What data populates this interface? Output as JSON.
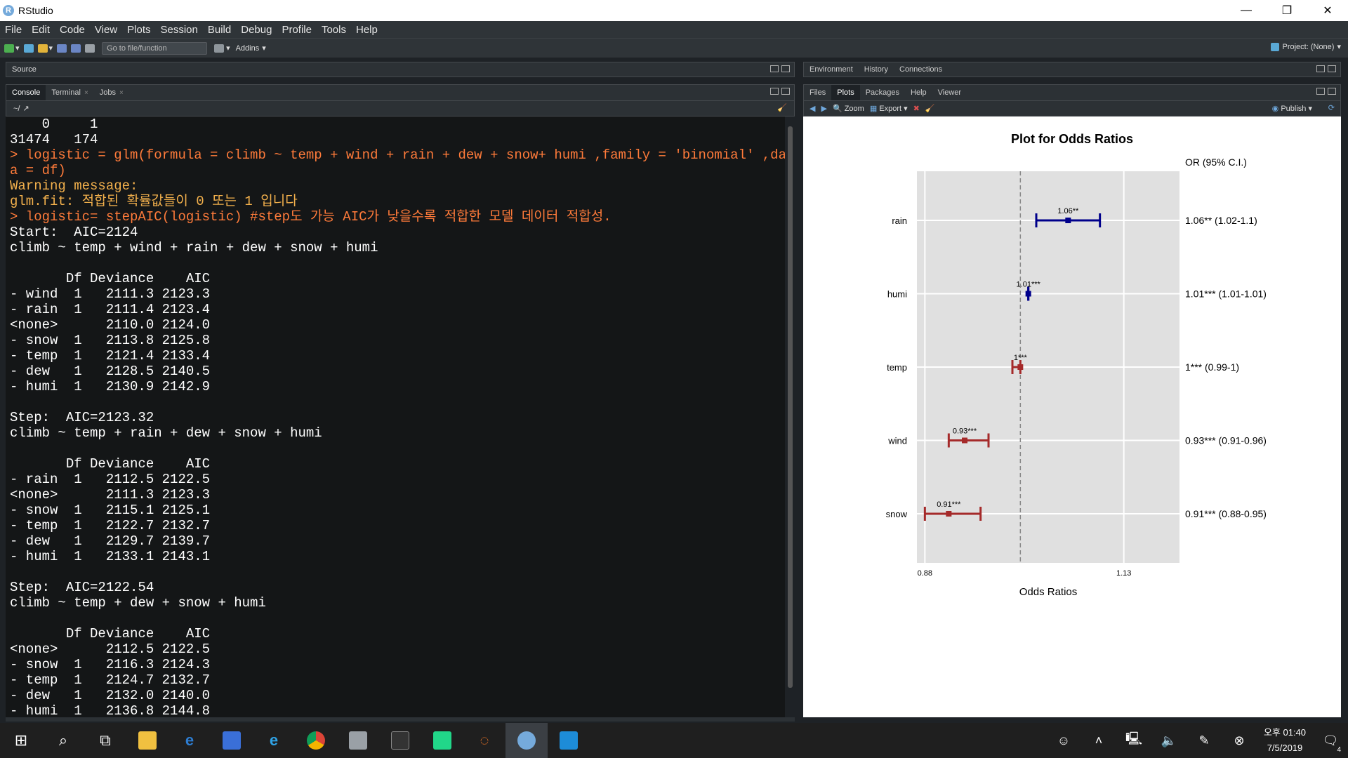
{
  "window": {
    "title": "RStudio",
    "minimize": "—",
    "restore": "❐",
    "close": "✕"
  },
  "menu": [
    "File",
    "Edit",
    "Code",
    "View",
    "Plots",
    "Session",
    "Build",
    "Debug",
    "Profile",
    "Tools",
    "Help"
  ],
  "toolbar": {
    "goto_placeholder": "Go to file/function",
    "addins": "Addins",
    "project": "Project: (None)"
  },
  "source_pane": {
    "label": "Source"
  },
  "console_pane": {
    "tabs": [
      {
        "label": "Console"
      },
      {
        "label": "Terminal"
      },
      {
        "label": "Jobs"
      }
    ],
    "path": "~/",
    "lines": [
      {
        "t": "out",
        "text": "    0     1"
      },
      {
        "t": "out",
        "text": "31474   174"
      },
      {
        "t": "cmd",
        "text": "> logistic = glm(formula = climb ~ temp + wind + rain + dew + snow+ humi ,family = 'binomial' ,dat"
      },
      {
        "t": "cmd",
        "text": "a = df)"
      },
      {
        "t": "warn",
        "text": "Warning message:"
      },
      {
        "t": "warn",
        "text": "glm.fit: 적합된 확률값들이 0 또는 1 입니다"
      },
      {
        "t": "cmd",
        "text": "> logistic= stepAIC(logistic) #step도 가능 AIC가 낮을수록 적합한 모델 데이터 적합성."
      },
      {
        "t": "out",
        "text": "Start:  AIC=2124"
      },
      {
        "t": "out",
        "text": "climb ~ temp + wind + rain + dew + snow + humi"
      },
      {
        "t": "out",
        "text": ""
      },
      {
        "t": "out",
        "text": "       Df Deviance    AIC"
      },
      {
        "t": "out",
        "text": "- wind  1   2111.3 2123.3"
      },
      {
        "t": "out",
        "text": "- rain  1   2111.4 2123.4"
      },
      {
        "t": "out",
        "text": "<none>      2110.0 2124.0"
      },
      {
        "t": "out",
        "text": "- snow  1   2113.8 2125.8"
      },
      {
        "t": "out",
        "text": "- temp  1   2121.4 2133.4"
      },
      {
        "t": "out",
        "text": "- dew   1   2128.5 2140.5"
      },
      {
        "t": "out",
        "text": "- humi  1   2130.9 2142.9"
      },
      {
        "t": "out",
        "text": ""
      },
      {
        "t": "out",
        "text": "Step:  AIC=2123.32"
      },
      {
        "t": "out",
        "text": "climb ~ temp + rain + dew + snow + humi"
      },
      {
        "t": "out",
        "text": ""
      },
      {
        "t": "out",
        "text": "       Df Deviance    AIC"
      },
      {
        "t": "out",
        "text": "- rain  1   2112.5 2122.5"
      },
      {
        "t": "out",
        "text": "<none>      2111.3 2123.3"
      },
      {
        "t": "out",
        "text": "- snow  1   2115.1 2125.1"
      },
      {
        "t": "out",
        "text": "- temp  1   2122.7 2132.7"
      },
      {
        "t": "out",
        "text": "- dew   1   2129.7 2139.7"
      },
      {
        "t": "out",
        "text": "- humi  1   2133.1 2143.1"
      },
      {
        "t": "out",
        "text": ""
      },
      {
        "t": "out",
        "text": "Step:  AIC=2122.54"
      },
      {
        "t": "out",
        "text": "climb ~ temp + dew + snow + humi"
      },
      {
        "t": "out",
        "text": ""
      },
      {
        "t": "out",
        "text": "       Df Deviance    AIC"
      },
      {
        "t": "out",
        "text": "<none>      2112.5 2122.5"
      },
      {
        "t": "out",
        "text": "- snow  1   2116.3 2124.3"
      },
      {
        "t": "out",
        "text": "- temp  1   2124.7 2132.7"
      },
      {
        "t": "out",
        "text": "- dew   1   2132.0 2140.0"
      },
      {
        "t": "out",
        "text": "- humi  1   2136.8 2144.8"
      }
    ]
  },
  "env_pane": {
    "tabs": [
      {
        "label": "Environment"
      },
      {
        "label": "History"
      },
      {
        "label": "Connections"
      }
    ]
  },
  "files_pane": {
    "tabs": [
      {
        "label": "Files"
      },
      {
        "label": "Plots"
      },
      {
        "label": "Packages"
      },
      {
        "label": "Help"
      },
      {
        "label": "Viewer"
      }
    ],
    "zoom": "Zoom",
    "export": "Export",
    "publish": "Publish"
  },
  "chart_data": {
    "type": "forest",
    "title": "Plot for Odds Ratios",
    "xlabel": "Odds Ratios",
    "right_header": "OR (95% C.I.)",
    "x_ticks": [
      0.88,
      1.13
    ],
    "x_tick_labels": [
      "0.88",
      "1.13"
    ],
    "xlim": [
      0.87,
      1.2
    ],
    "ref_line": 1.0,
    "rows": [
      {
        "label": "rain",
        "or": 1.06,
        "lo": 1.02,
        "hi": 1.1,
        "text": "1.06**",
        "ci_text": "1.06** (1.02-1.1)",
        "color": "#00008b"
      },
      {
        "label": "humi",
        "or": 1.01,
        "lo": 1.01,
        "hi": 1.01,
        "text": "1.01***",
        "ci_text": "1.01*** (1.01-1.01)",
        "color": "#00008b"
      },
      {
        "label": "temp",
        "or": 1.0,
        "lo": 0.99,
        "hi": 1.0,
        "text": "1***",
        "ci_text": "1*** (0.99-1)",
        "color": "#a52a2a"
      },
      {
        "label": "wind",
        "or": 0.93,
        "lo": 0.91,
        "hi": 0.96,
        "text": "0.93***",
        "ci_text": "0.93*** (0.91-0.96)",
        "color": "#a52a2a"
      },
      {
        "label": "snow",
        "or": 0.91,
        "lo": 0.88,
        "hi": 0.95,
        "text": "0.91***",
        "ci_text": "0.91*** (0.88-0.95)",
        "color": "#a52a2a"
      }
    ]
  },
  "taskbar": {
    "time": "오후 01:40",
    "date": "7/5/2019",
    "notifications": "4"
  }
}
